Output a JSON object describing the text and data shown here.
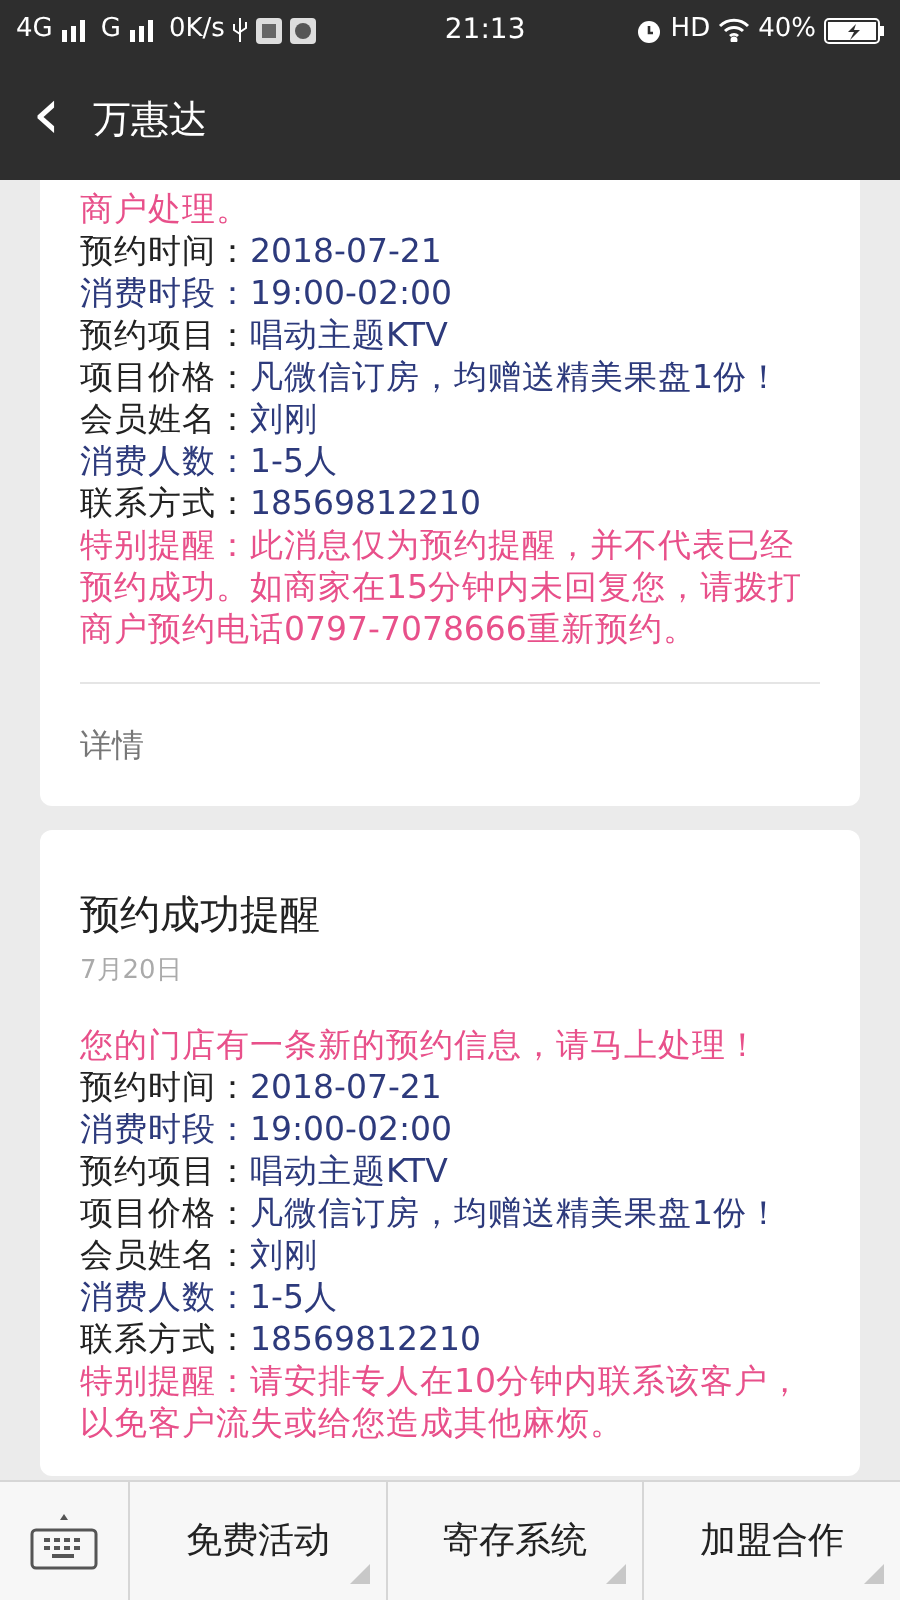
{
  "status_bar": {
    "network_1": "4G",
    "network_2": "G",
    "speed": "0K/s",
    "time": "21:13",
    "hd": "HD",
    "battery": "40%"
  },
  "header": {
    "back": "‹",
    "title": "万惠达"
  },
  "cards": [
    {
      "intro": "商户处理。",
      "fields": [
        {
          "label": "预约时间：",
          "value": "2018-07-21",
          "kind": "plain"
        },
        {
          "label": "消费时段：",
          "value": "19:00-02:00",
          "kind": "accent"
        },
        {
          "label": "预约项目：",
          "value": "唱动主题KTV",
          "kind": "plain"
        },
        {
          "label": "项目价格：",
          "value": "凡微信订房，均赠送精美果盘1份！",
          "kind": "plain"
        },
        {
          "label": "会员姓名：",
          "value": "刘刚",
          "kind": "plain"
        },
        {
          "label": "消费人数：",
          "value": "1-5人",
          "kind": "accent"
        },
        {
          "label": "联系方式：",
          "value": "18569812210",
          "kind": "plain"
        }
      ],
      "reminder": "特别提醒：此消息仅为预约提醒，并不代表已经预约成功。如商家在15分钟内未回复您，请拨打商户预约电话0797-7078666重新预约。",
      "details": "详情"
    },
    {
      "title": "预约成功提醒",
      "date": "7月20日",
      "intro": "您的门店有一条新的预约信息，请马上处理！",
      "fields": [
        {
          "label": "预约时间：",
          "value": "2018-07-21",
          "kind": "plain"
        },
        {
          "label": "消费时段：",
          "value": "19:00-02:00",
          "kind": "accent"
        },
        {
          "label": "预约项目：",
          "value": "唱动主题KTV",
          "kind": "plain"
        },
        {
          "label": "项目价格：",
          "value": "凡微信订房，均赠送精美果盘1份！",
          "kind": "plain"
        },
        {
          "label": "会员姓名：",
          "value": "刘刚",
          "kind": "plain"
        },
        {
          "label": "消费人数：",
          "value": "1-5人",
          "kind": "accent"
        },
        {
          "label": "联系方式：",
          "value": "18569812210",
          "kind": "plain"
        }
      ],
      "reminder": "特别提醒：请安排专人在10分钟内联系该客户，以免客户流失或给您造成其他麻烦。"
    }
  ],
  "menu": [
    {
      "label": "免费活动"
    },
    {
      "label": "寄存系统"
    },
    {
      "label": "加盟合作"
    }
  ]
}
